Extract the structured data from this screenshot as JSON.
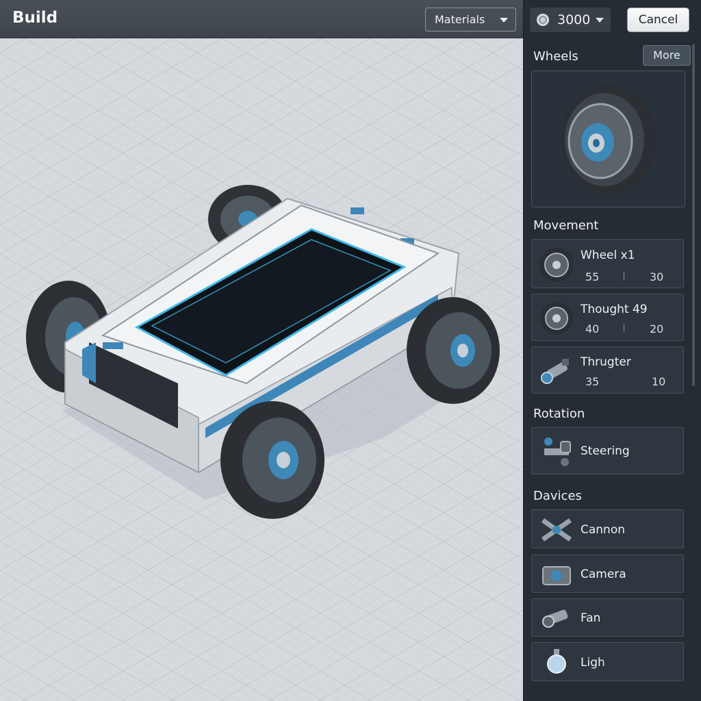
{
  "header": {
    "title": "Build",
    "materials_label": "Materials"
  },
  "currency": {
    "value": "3000",
    "icon": "coin-icon"
  },
  "actions": {
    "cancel_label": "Cancel"
  },
  "panel": {
    "wheels": {
      "title": "Wheels",
      "more_label": "More"
    },
    "movement": {
      "title": "Movement",
      "items": [
        {
          "name": "Wheel x1",
          "stat_a": "55",
          "stat_b": "30",
          "icon": "wheel-icon"
        },
        {
          "name": "Thought 49",
          "stat_a": "40",
          "stat_b": "20",
          "icon": "wheel-icon"
        },
        {
          "name": "Thrugter",
          "stat_a": "35",
          "stat_b": "10",
          "icon": "thruster-icon"
        }
      ]
    },
    "rotation": {
      "title": "Rotation",
      "items": [
        {
          "name": "Steering",
          "icon": "steering-icon"
        }
      ]
    },
    "devices": {
      "title": "Davices",
      "items": [
        {
          "name": "Cannon",
          "icon": "cannon-icon"
        },
        {
          "name": "Camera",
          "icon": "camera-icon"
        },
        {
          "name": "Fan",
          "icon": "fan-icon"
        },
        {
          "name": "Ligh",
          "icon": "light-icon"
        }
      ]
    }
  },
  "colors": {
    "accent": "#3fb6e8",
    "panel_bg": "#262c33",
    "card_bg": "#2e363f",
    "viewport_bg": "#d4d8dd"
  }
}
